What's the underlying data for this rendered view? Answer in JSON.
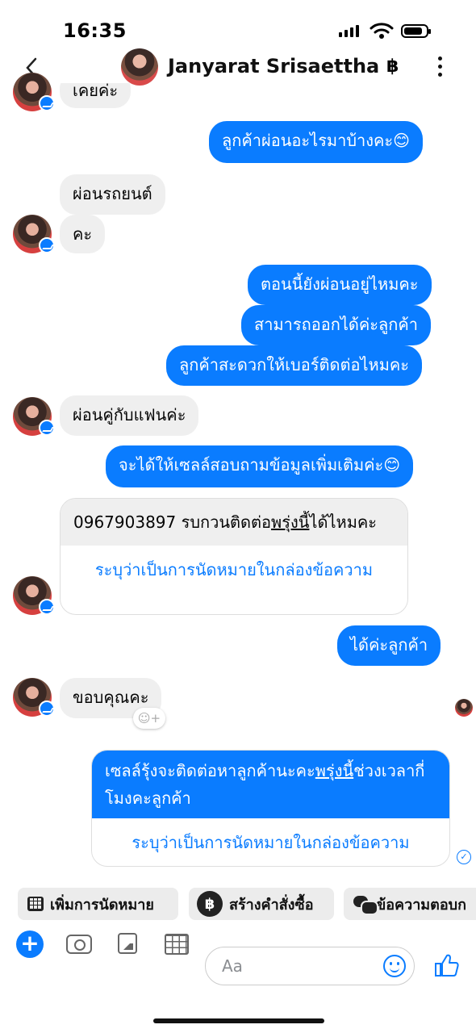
{
  "status_bar": {
    "time": "16:35"
  },
  "header": {
    "contact_name": "Janyarat Srisaettha",
    "currency_icon": "฿",
    "back_icon": "chevron-left-icon",
    "more_icon": "more-vertical-icon"
  },
  "conversation": {
    "m0": "เคยค่ะ",
    "m1": "ลูกค้าผ่อนอะไรมาบ้างคะ😊",
    "m2": "ผ่อนรถยนต์",
    "m3": "คะ",
    "m4": "ตอนนี้ยังผ่อนอยู่ไหมคะ",
    "m5": "สามารถออกได้ค่ะลูกค้า",
    "m6": "ลูกค้าสะดวกให้เบอร์ติดต่อไหมคะ",
    "m7": "ผ่อนคู่กับแฟนค่ะ",
    "m8": "จะได้ให้เซลล์สอบถามข้อมูลเพิ่มเติมค่ะ😊",
    "m9": {
      "text_before": "0967903897 รบกวนติดต่อ",
      "link": "พรุ่งนี้",
      "text_after": "ได้ไหมคะ",
      "action": "ระบุว่าเป็นการนัดหมายในกล่องข้อความ"
    },
    "m10": "ได้ค่ะลูกค้า",
    "m11": "ขอบคุณคะ",
    "m12": {
      "text_before": "เซลล์รุ้งจะติดต่อหาลูกค้านะคะ",
      "link": "พรุ่งนี้",
      "text_after": "ช่วงเวลากี่โมงคะลูกค้า",
      "action": "ระบุว่าเป็นการนัดหมายในกล่องข้อความ"
    }
  },
  "quick_actions": {
    "appointment": "เพิ่มการนัดหมาย",
    "order_icon": "฿",
    "order": "สร้างคำสั่งซื้อ",
    "saved_reply": "ข้อความตอบก"
  },
  "composer": {
    "placeholder": "Aa",
    "plus": "+",
    "like_icon": "👍"
  },
  "colors": {
    "accent": "#0a7cff",
    "incoming": "#efefef"
  }
}
